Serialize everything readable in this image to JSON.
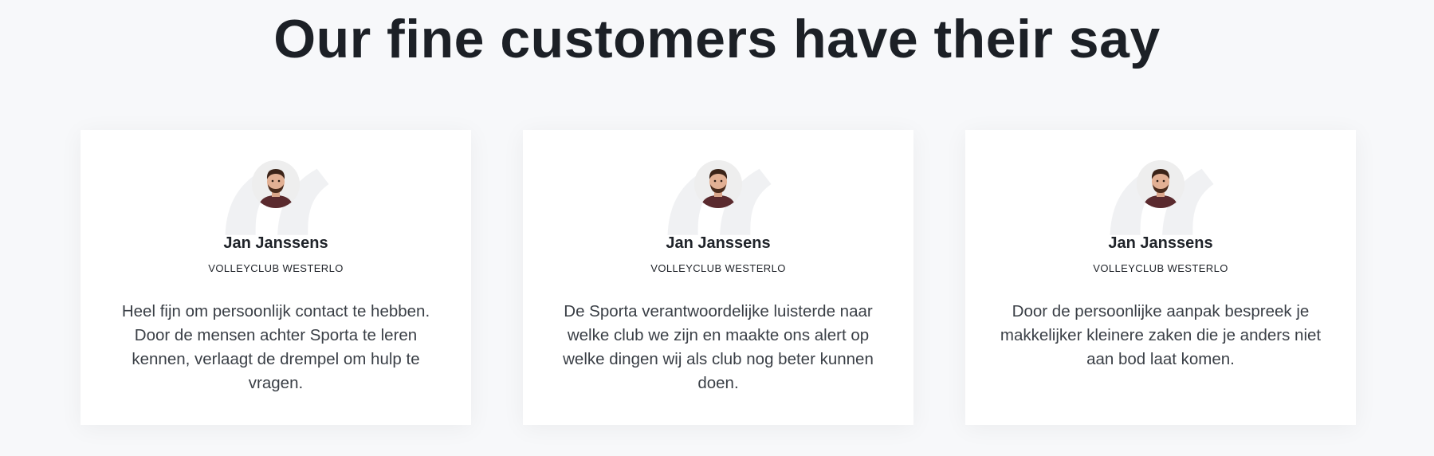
{
  "section": {
    "title": "Our fine customers have their say"
  },
  "testimonials": [
    {
      "name": "Jan Janssens",
      "club": "VOLLEYCLUB WESTERLO",
      "quote": "Heel fijn om persoonlijk contact te hebben. Door de mensen achter Sporta te leren kennen, verlaagt de drempel om hulp te vragen."
    },
    {
      "name": "Jan Janssens",
      "club": "VOLLEYCLUB WESTERLO",
      "quote": "De Sporta verantwoordelijke luisterde naar welke club we zijn en maakte ons alert op welke dingen wij als club nog beter kunnen doen."
    },
    {
      "name": "Jan Janssens",
      "club": "VOLLEYCLUB WESTERLO",
      "quote": "Door de persoonlijke aanpak bespreek je makkelijker kleinere zaken die je anders niet aan bod laat komen."
    }
  ],
  "icons": {
    "avatar": "person-avatar-photo",
    "quote": "quote-mark-icon"
  },
  "colors": {
    "background": "#f7f8fa",
    "card": "#ffffff",
    "heading": "#1c2026",
    "quote_mark": "#f0f1f3"
  }
}
